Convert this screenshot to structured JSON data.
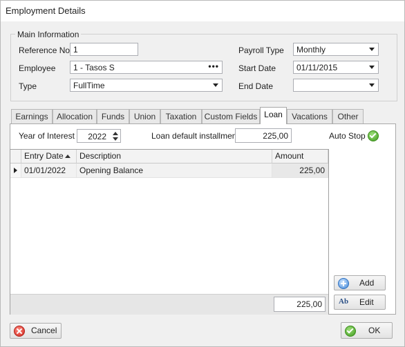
{
  "window": {
    "title": "Employment Details"
  },
  "main_info": {
    "legend": "Main Information",
    "reference_no": {
      "label": "Reference No",
      "value": "1"
    },
    "employee": {
      "label": "Employee",
      "value": "1 - Tasos S",
      "button": "•••"
    },
    "type": {
      "label": "Type",
      "value": "FullTime"
    },
    "payroll_type": {
      "label": "Payroll Type",
      "value": "Monthly"
    },
    "start_date": {
      "label": "Start Date",
      "value": "01/11/2015"
    },
    "end_date": {
      "label": "End Date",
      "value": ""
    }
  },
  "tabs": [
    {
      "label": "Earnings",
      "active": false
    },
    {
      "label": "Allocation",
      "active": false
    },
    {
      "label": "Funds",
      "active": false
    },
    {
      "label": "Union",
      "active": false
    },
    {
      "label": "Taxation",
      "active": false
    },
    {
      "label": "Custom Fields",
      "active": false
    },
    {
      "label": "Loan",
      "active": true
    },
    {
      "label": "Vacations",
      "active": false
    },
    {
      "label": "Other",
      "active": false
    }
  ],
  "loan": {
    "year_label": "Year of Interest",
    "year_value": "2022",
    "installment_label": "Loan default installment",
    "installment_value": "225,00",
    "auto_stop_label": "Auto Stop",
    "auto_stop_checked": true,
    "grid": {
      "columns": [
        "Entry Date",
        "Description",
        "Amount"
      ],
      "sort_column": "Entry Date",
      "rows": [
        {
          "entry_date": "01/01/2022",
          "description": "Opening Balance",
          "amount": "225,00"
        }
      ],
      "total": "225,00"
    },
    "add_label": "Add",
    "edit_label": "Edit"
  },
  "footer": {
    "cancel_label": "Cancel",
    "ok_label": "OK"
  },
  "colors": {
    "accent_green": "#3f9a1e",
    "cancel_red": "#d0261c",
    "add_blue": "#3f86d8"
  }
}
